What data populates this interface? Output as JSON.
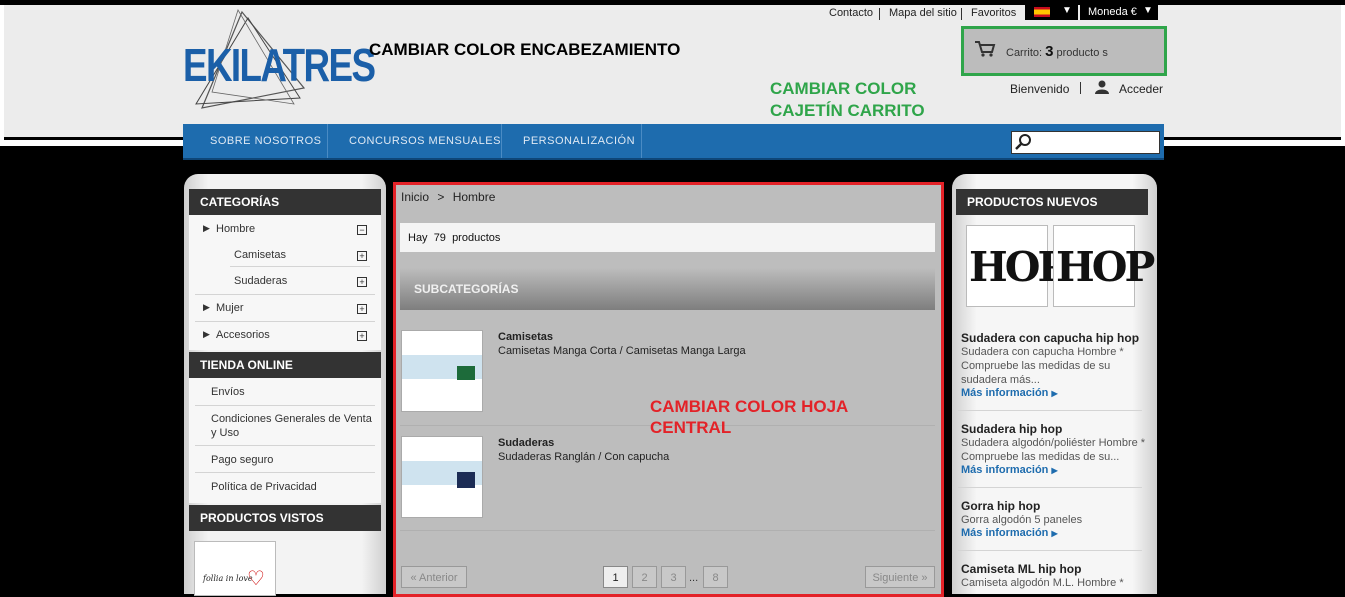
{
  "header": {
    "logo_text": "EKILATRES",
    "top_links": [
      "Contacto",
      "Mapa del sitio",
      "Favoritos"
    ],
    "currency": "Moneda €",
    "annotation": "CAMBIAR COLOR ENCABEZAMIENTO",
    "cart": {
      "label": "Carrito:",
      "count": "3",
      "suffix": "producto s"
    },
    "cart_annotation": [
      "CAMBIAR COLOR",
      "CAJETÍN CARRITO"
    ],
    "welcome": "Bienvenido",
    "login": "Acceder"
  },
  "nav": {
    "items": [
      "SOBRE NOSOTROS",
      "CONCURSOS MENSUALES",
      "PERSONALIZACIÓN"
    ],
    "search_placeholder": ""
  },
  "left": {
    "categories_title": "CATEGORÍAS",
    "categories": [
      {
        "label": "Hombre",
        "toggle": "−"
      },
      {
        "label": "Camisetas",
        "toggle": "+"
      },
      {
        "label": "Sudaderas",
        "toggle": "+"
      },
      {
        "label": "Mujer",
        "toggle": "+"
      },
      {
        "label": "Accesorios",
        "toggle": "+"
      }
    ],
    "store_title": "TIENDA ONLINE",
    "store_links": [
      "Envíos",
      "Condiciones Generales de Venta",
      "y Uso",
      "Pago seguro",
      "Política de Privacidad"
    ],
    "viewed_title": "PRODUCTOS VISTOS",
    "viewed_thumb_text": "follia  in love"
  },
  "center": {
    "breadcrumb": [
      "Inicio",
      ">",
      "Hombre"
    ],
    "count": {
      "prefix": "Hay",
      "number": "79",
      "suffix": "productos"
    },
    "subcategories_title": "SUBCATEGORÍAS",
    "subcategories": [
      {
        "name": "Camisetas",
        "desc": "Camisetas Manga Corta / Camisetas Manga Larga"
      },
      {
        "name": "Sudaderas",
        "desc": "Sudaderas Ranglán / Con capucha"
      }
    ],
    "annotation": [
      "CAMBIAR COLOR HOJA",
      "CENTRAL"
    ],
    "pagination": {
      "prev": "« Anterior",
      "pages": [
        "1",
        "2",
        "3",
        "8"
      ],
      "ellipsis": "...",
      "next": "Siguiente »",
      "current": "1"
    }
  },
  "right": {
    "title": "PRODUCTOS NUEVOS",
    "thumb_text": "HOP",
    "products": [
      {
        "title": "Sudadera con capucha hip hop",
        "desc": [
          "Sudadera con capucha Hombre *",
          "Compruebe las medidas de su",
          "sudadera más..."
        ],
        "more": "Más información"
      },
      {
        "title": "Sudadera hip hop",
        "desc": [
          "Sudadera algodón/poliéster Hombre *",
          "Compruebe las medidas de su..."
        ],
        "more": "Más información"
      },
      {
        "title": "Gorra hip hop",
        "desc": [
          "Gorra algodón 5 paneles"
        ],
        "more": "Más información"
      },
      {
        "title": "Camiseta ML hip hop",
        "desc": [
          "Camiseta algodón M.L. Hombre  *"
        ],
        "more": ""
      }
    ]
  },
  "colors": {
    "brand_blue": "#1e6cae",
    "cart_border": "#2fa54a",
    "center_border": "#e32228"
  }
}
